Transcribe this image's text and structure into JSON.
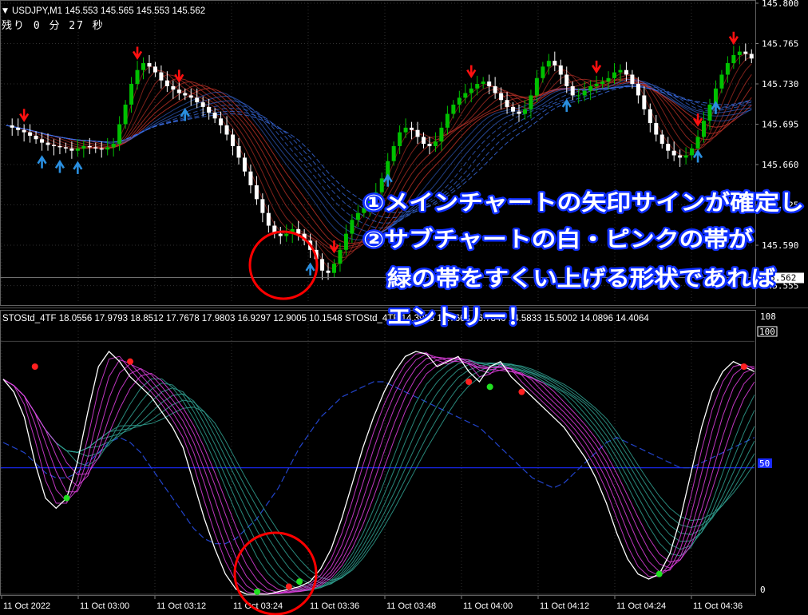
{
  "main": {
    "symbol_line": "USDJPY,M1  145.553 145.565 145.553 145.562",
    "timer": "残り 0 分 27 秒",
    "price_labels": [
      "145.800",
      "145.765",
      "145.730",
      "145.695",
      "145.660",
      "145.625",
      "145.590",
      "145.555"
    ],
    "current_price": "145.562"
  },
  "sub": {
    "indicator_line": "STOStd_4TF 18.0556 17.9793 18.8512 17.7678 17.9803 16.9297 12.9005 10.1548  STOStd_4TF 14.3935 15.7663 16.7840 14.5833 15.5002 14.0896 14.4064",
    "scale_top": "108",
    "level_100": "100",
    "level_50": "50",
    "level_0": "0"
  },
  "time_labels": [
    "11 Oct 2022",
    "11 Oct 03:00",
    "11 Oct 03:12",
    "11 Oct 03:24",
    "11 Oct 03:36",
    "11 Oct 03:48",
    "11 Oct 04:00",
    "11 Oct 04:12",
    "11 Oct 04:24",
    "11 Oct 04:36"
  ],
  "annotation": {
    "line1": "①メインチャートの矢印サインが確定し",
    "line2": "②サブチャートの白・ピンクの帯が",
    "line3": "緑の帯をすくい上げる形状であれば",
    "line4": "エントリー！"
  },
  "colors": {
    "background": "#000000",
    "bull_candle": "#00c000",
    "bear_candle": "#ffffff",
    "down_arrow": "#ff1010",
    "up_arrow": "#2a8fe0",
    "red_band": "#c8342a",
    "blue_band": "#3a6fe8",
    "stoch_white": "#ffffff",
    "stoch_magenta": "#e040e0",
    "stoch_teal": "#30a090",
    "signal_dot_green": "#20e020",
    "signal_dot_red": "#ff2020",
    "level_line": "#1a2aff",
    "circle": "#ff0000",
    "annotation_text": "#ffffff",
    "annotation_outline": "#1030ff"
  },
  "chart_data": {
    "type": "candlestick",
    "symbol": "USDJPY",
    "timeframe": "M1",
    "ylim": [
      145.545,
      145.8
    ],
    "y_ticks": [
      145.8,
      145.765,
      145.73,
      145.695,
      145.66,
      145.625,
      145.59,
      145.555
    ],
    "x_tick_labels": [
      "11 Oct 2022",
      "11 Oct 03:00",
      "11 Oct 03:12",
      "11 Oct 03:24",
      "11 Oct 03:36",
      "11 Oct 03:48",
      "11 Oct 04:00",
      "11 Oct 04:12",
      "11 Oct 04:24",
      "11 Oct 04:36"
    ],
    "close_path": [
      145.694,
      145.692,
      145.69,
      145.688,
      145.685,
      145.682,
      145.679,
      145.677,
      145.676,
      145.675,
      145.674,
      145.672,
      145.674,
      145.676,
      145.675,
      145.674,
      145.673,
      145.675,
      145.678,
      145.695,
      145.712,
      145.73,
      145.742,
      145.748,
      145.745,
      145.74,
      145.733,
      145.728,
      145.725,
      145.722,
      145.72,
      145.718,
      145.714,
      145.71,
      145.705,
      145.7,
      145.694,
      145.686,
      145.676,
      145.666,
      145.654,
      145.642,
      145.63,
      145.618,
      145.607,
      145.6,
      145.598,
      145.6,
      145.604,
      145.6,
      145.594,
      145.586,
      145.578,
      145.568,
      145.566,
      145.574,
      145.586,
      145.6,
      145.612,
      145.618,
      145.622,
      145.628,
      145.636,
      145.648,
      145.663,
      145.676,
      145.688,
      145.692,
      145.69,
      145.684,
      145.678,
      145.676,
      145.68,
      145.692,
      145.704,
      145.712,
      145.718,
      145.722,
      145.726,
      145.73,
      145.732,
      145.728,
      145.722,
      145.716,
      145.71,
      145.706,
      145.704,
      145.708,
      145.72,
      145.735,
      145.745,
      145.75,
      145.746,
      145.738,
      145.728,
      145.72,
      145.72,
      145.724,
      145.728,
      145.73,
      145.732,
      145.735,
      145.74,
      145.742,
      145.738,
      145.73,
      145.72,
      145.708,
      145.696,
      145.686,
      145.678,
      145.672,
      145.668,
      145.666,
      145.668,
      145.674,
      145.684,
      145.698,
      145.712,
      145.726,
      145.738,
      145.748,
      145.755,
      145.758,
      145.756,
      145.752
    ],
    "down_arrows_at": [
      3,
      22,
      29,
      55,
      78,
      99,
      116,
      122
    ],
    "up_arrows_at": [
      6,
      9,
      12,
      30,
      51,
      64,
      94,
      116,
      119
    ],
    "sub_indicator": {
      "name": "STOStd_4TF",
      "levels": [
        0,
        50,
        100
      ],
      "ylim": [
        0,
        108
      ],
      "main_line": [
        85,
        80,
        70,
        52,
        38,
        34,
        38,
        52,
        72,
        90,
        96,
        92,
        86,
        82,
        78,
        72,
        66,
        58,
        44,
        30,
        18,
        8,
        2,
        0,
        0,
        0,
        1,
        2,
        3,
        5,
        10,
        18,
        30,
        44,
        58,
        70,
        80,
        88,
        94,
        96,
        95,
        90,
        92,
        94,
        88,
        84,
        90,
        92,
        86,
        82,
        78,
        74,
        70,
        66,
        60,
        54,
        46,
        36,
        24,
        14,
        8,
        6,
        8,
        16,
        30,
        48,
        66,
        80,
        88,
        92,
        90,
        88
      ],
      "slow_line": [
        60,
        58,
        56,
        52,
        48,
        46,
        46,
        48,
        52,
        56,
        60,
        62,
        60,
        56,
        50,
        44,
        38,
        32,
        26,
        22,
        20,
        20,
        22,
        26,
        30,
        36,
        42,
        50,
        58,
        64,
        70,
        74,
        78,
        80,
        82,
        84,
        84,
        82,
        80,
        78,
        76,
        74,
        72,
        70,
        68,
        66,
        62,
        58,
        54,
        50,
        46,
        44,
        42,
        44,
        48,
        52,
        56,
        60,
        62,
        60,
        58,
        56,
        54,
        52,
        50,
        50,
        52,
        54,
        56,
        58,
        60,
        62
      ]
    }
  }
}
